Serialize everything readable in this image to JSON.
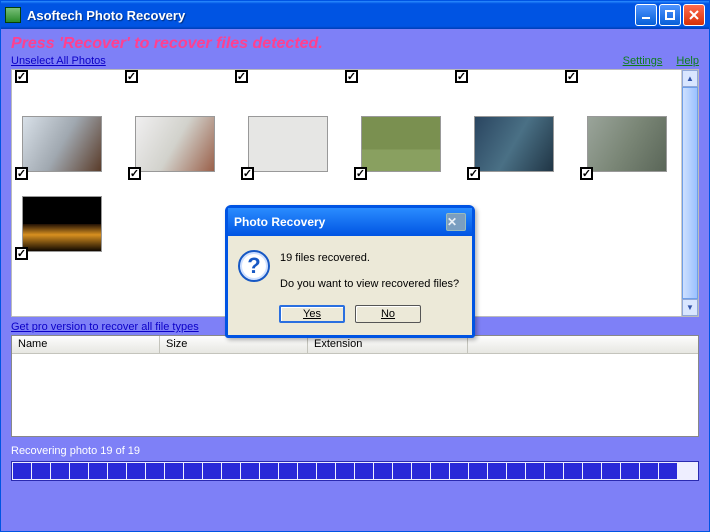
{
  "window": {
    "title": "Asoftech Photo Recovery"
  },
  "instruction": "Press 'Recover' to recover files detected.",
  "links": {
    "unselect": "Unselect All Photos",
    "settings": "Settings",
    "help": "Help",
    "pro": "Get pro version to recover all file types"
  },
  "table": {
    "col1": "Name",
    "col2": "Size",
    "col3": "Extension"
  },
  "status": "Recovering photo 19 of 19",
  "progress": {
    "segments": 35
  },
  "dialog": {
    "title": "Photo Recovery",
    "line1": "19 files recovered.",
    "line2": "Do you want to view recovered files?",
    "yes": "Yes",
    "no": "No"
  },
  "thumbs": {
    "top_checks": 6,
    "items": [
      {
        "cls": "p1"
      },
      {
        "cls": "p2"
      },
      {
        "cls": "p3"
      },
      {
        "cls": "p4"
      },
      {
        "cls": "p5"
      },
      {
        "cls": "p6"
      },
      {
        "cls": "p7"
      }
    ]
  }
}
